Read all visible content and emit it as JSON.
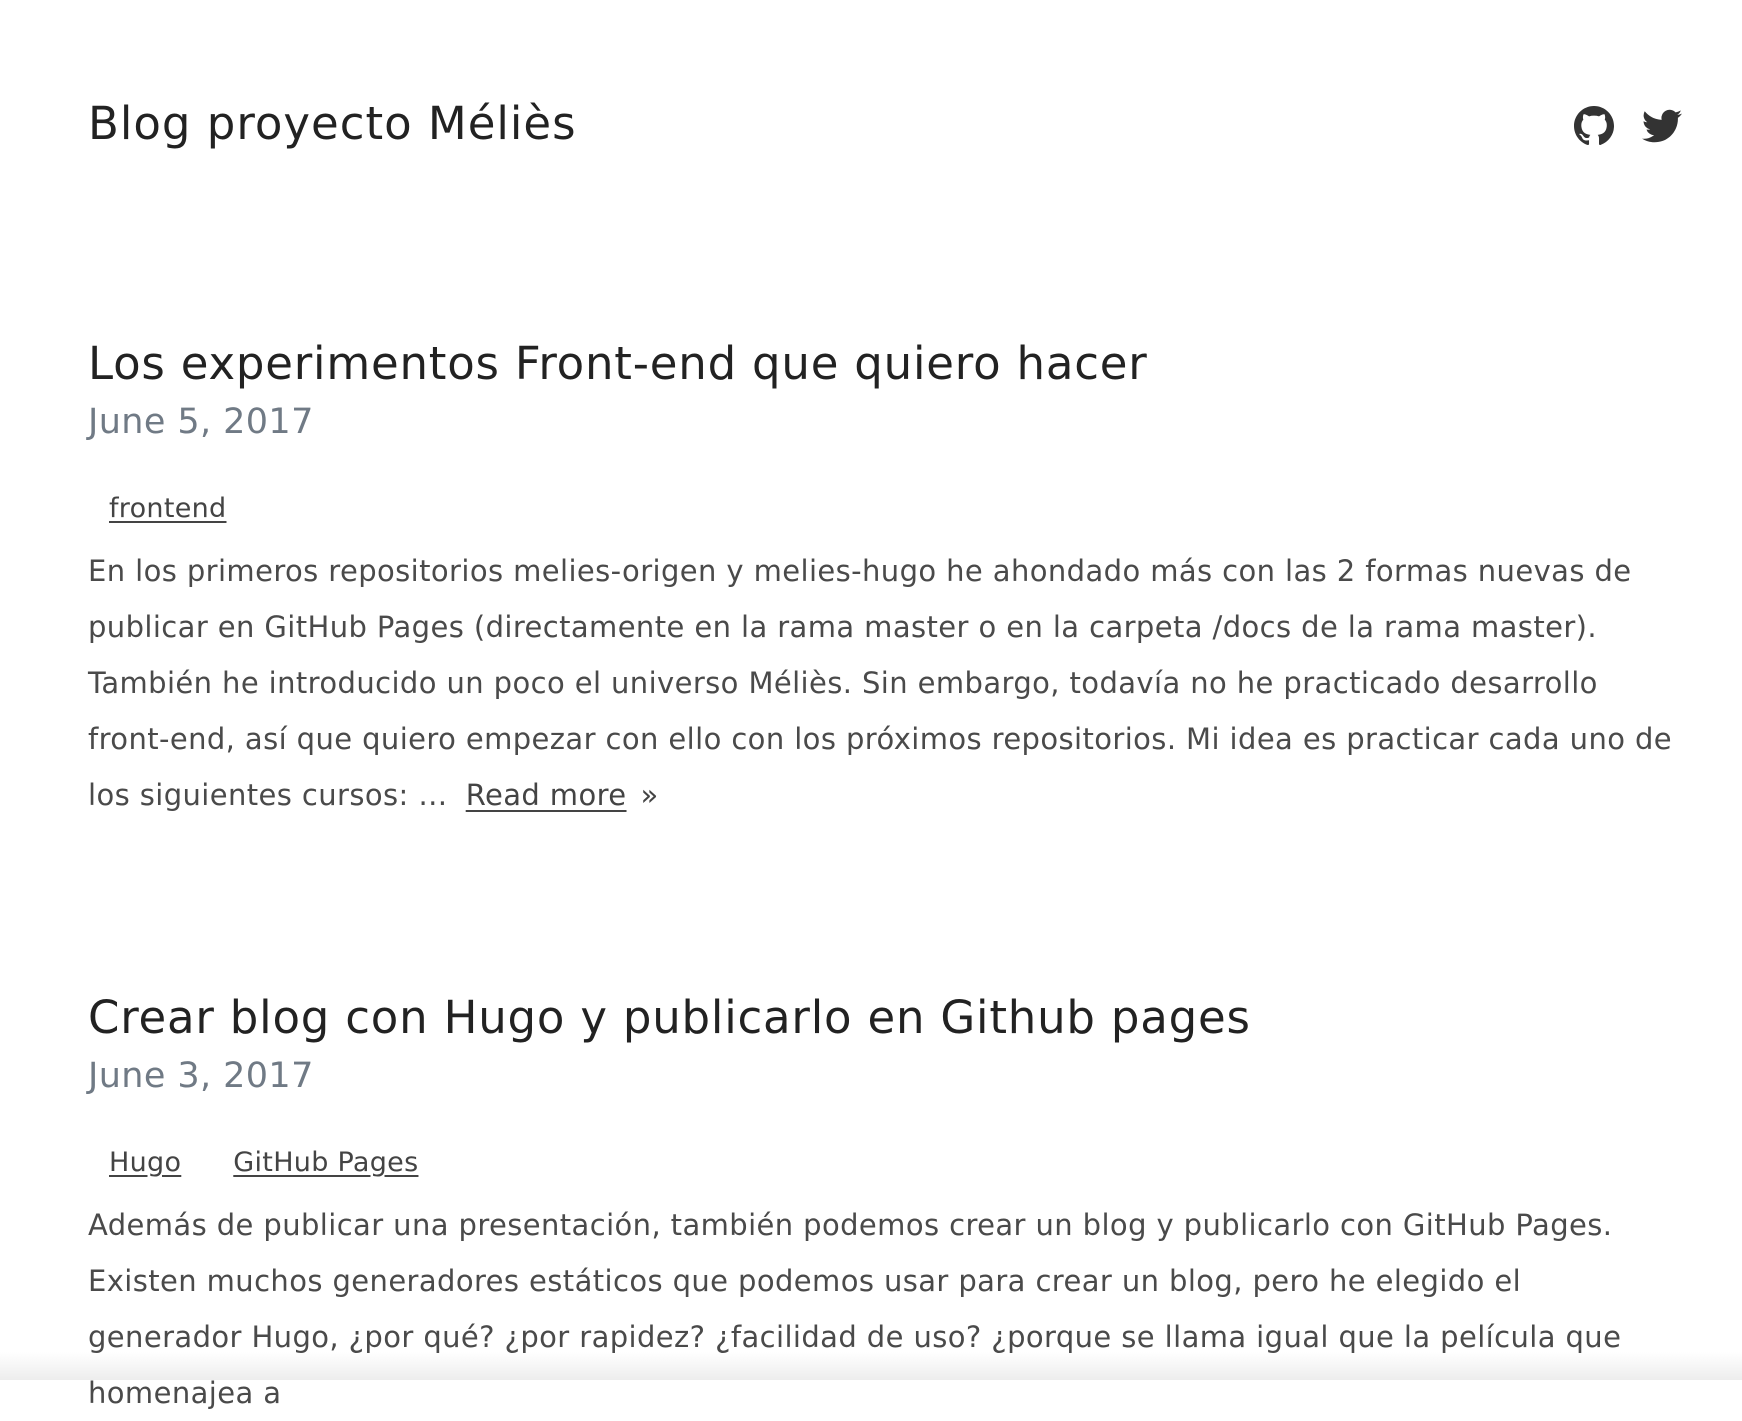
{
  "site": {
    "title": "Blog proyecto Méliès"
  },
  "social": [
    {
      "name": "github-icon"
    },
    {
      "name": "twitter-icon"
    }
  ],
  "posts": [
    {
      "title": "Los experimentos Front-end que quiero hacer",
      "date": "June 5, 2017",
      "tags": [
        "frontend"
      ],
      "summary": "En los primeros repositorios melies-origen y melies-hugo he ahondado más con las 2 formas nuevas de publicar en GitHub Pages (directamente en la rama master o en la carpeta /docs de la rama master). También he introducido un poco el universo Méliès. Sin embargo, todavía no he practicado desarrollo front-end, así que quiero empezar con ello con los próximos repositorios. Mi idea es practicar cada uno de los siguientes cursos: …",
      "read_more": "Read more",
      "chevron": "»"
    },
    {
      "title": "Crear blog con Hugo y publicarlo en Github pages",
      "date": "June 3, 2017",
      "tags": [
        "Hugo",
        "GitHub Pages"
      ],
      "summary": "Además de publicar una presentación, también podemos crear un blog y publicarlo con GitHub Pages. Existen muchos generadores estáticos que podemos usar para crear un blog, pero he elegido el generador Hugo, ¿por qué? ¿por rapidez? ¿facilidad de uso? ¿porque se llama igual que la película que homenajea a"
    }
  ]
}
